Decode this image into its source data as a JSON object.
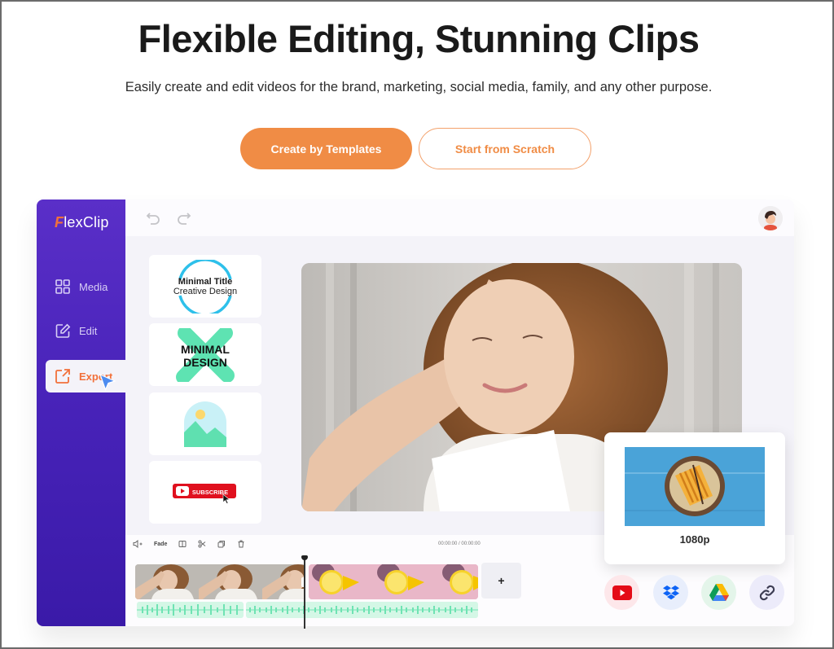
{
  "hero": {
    "title": "Flexible Editing, Stunning Clips",
    "subtitle": "Easily create and edit videos for the brand, marketing, social media, family, and any other purpose.",
    "primary_button": "Create by Templates",
    "secondary_button": "Start from Scratch"
  },
  "colors": {
    "accent_orange": "#f08c45",
    "sidebar_purple": "#4722b8",
    "audio_green": "#6fe3b3"
  },
  "app": {
    "logo_first": "F",
    "logo_rest": "lexClip",
    "nav": [
      {
        "label": "Media",
        "icon": "grid-icon"
      },
      {
        "label": "Edit",
        "icon": "edit-icon"
      },
      {
        "label": "Export",
        "icon": "export-icon",
        "active": true
      }
    ],
    "toolbar": {
      "undo": "undo-icon",
      "redo": "redo-icon"
    },
    "templates": [
      {
        "line1": "Minimal Title",
        "line2": "Creative Design"
      },
      {
        "line1": "MINIMAL",
        "line2": "DESIGN"
      },
      {
        "type": "image-placeholder"
      },
      {
        "label": "SUBSCRIBE"
      }
    ],
    "timeline": {
      "tools": {
        "fade": "Fade"
      },
      "time": "00:00:00 / 00:00:00",
      "add_label": "+"
    },
    "export": {
      "resolution": "1080p",
      "share_targets": [
        "YouTube",
        "Dropbox",
        "Google Drive",
        "Link"
      ]
    }
  }
}
